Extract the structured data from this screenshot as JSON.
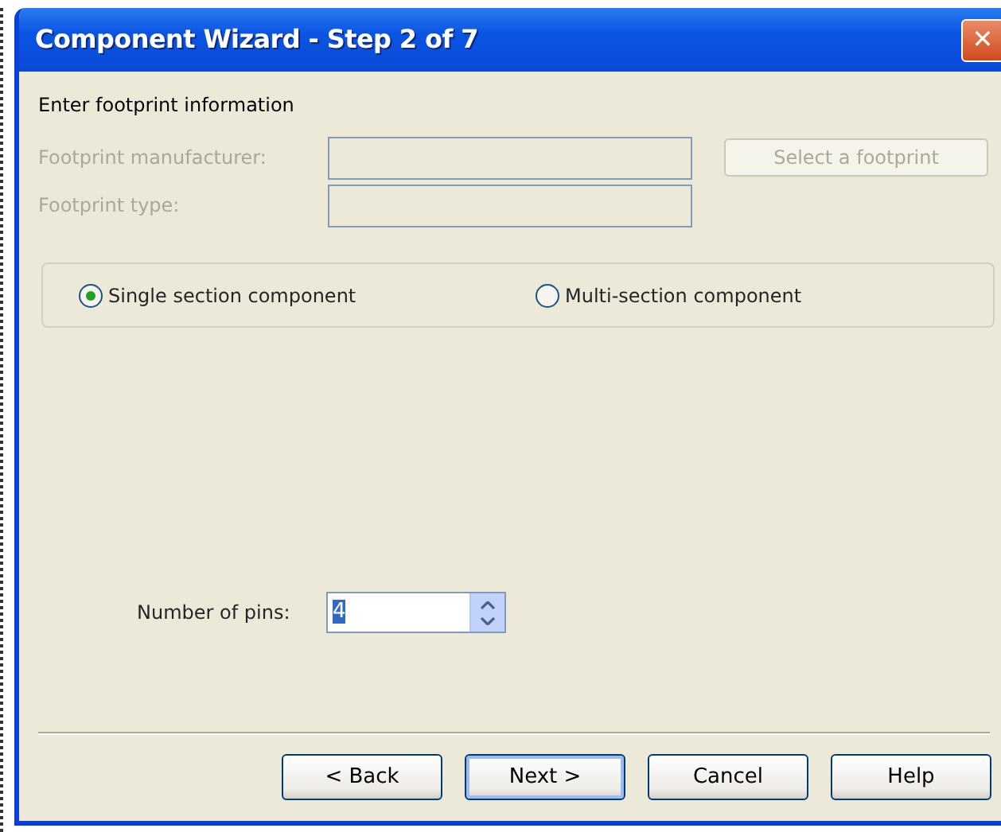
{
  "window": {
    "title": "Component Wizard - Step 2 of 7",
    "close": "✕"
  },
  "heading": "Enter footprint information",
  "fields": [
    {
      "label": "Footprint manufacturer:",
      "disabled": true
    },
    {
      "label": "Footprint type:",
      "disabled": true
    }
  ],
  "select_button": {
    "label": "Select a footprint",
    "disabled": true
  },
  "radios": [
    {
      "label": "Single section component",
      "selected": true
    },
    {
      "label": "Multi-section component",
      "selected": false
    }
  ],
  "pins": {
    "label": "Number of pins:",
    "value": "4",
    "value_selected": true
  },
  "buttons": [
    {
      "label": "< Back",
      "default": false
    },
    {
      "label": "Next >",
      "default": true
    },
    {
      "label": "Cancel",
      "default": false
    },
    {
      "label": "Help",
      "default": false
    }
  ]
}
